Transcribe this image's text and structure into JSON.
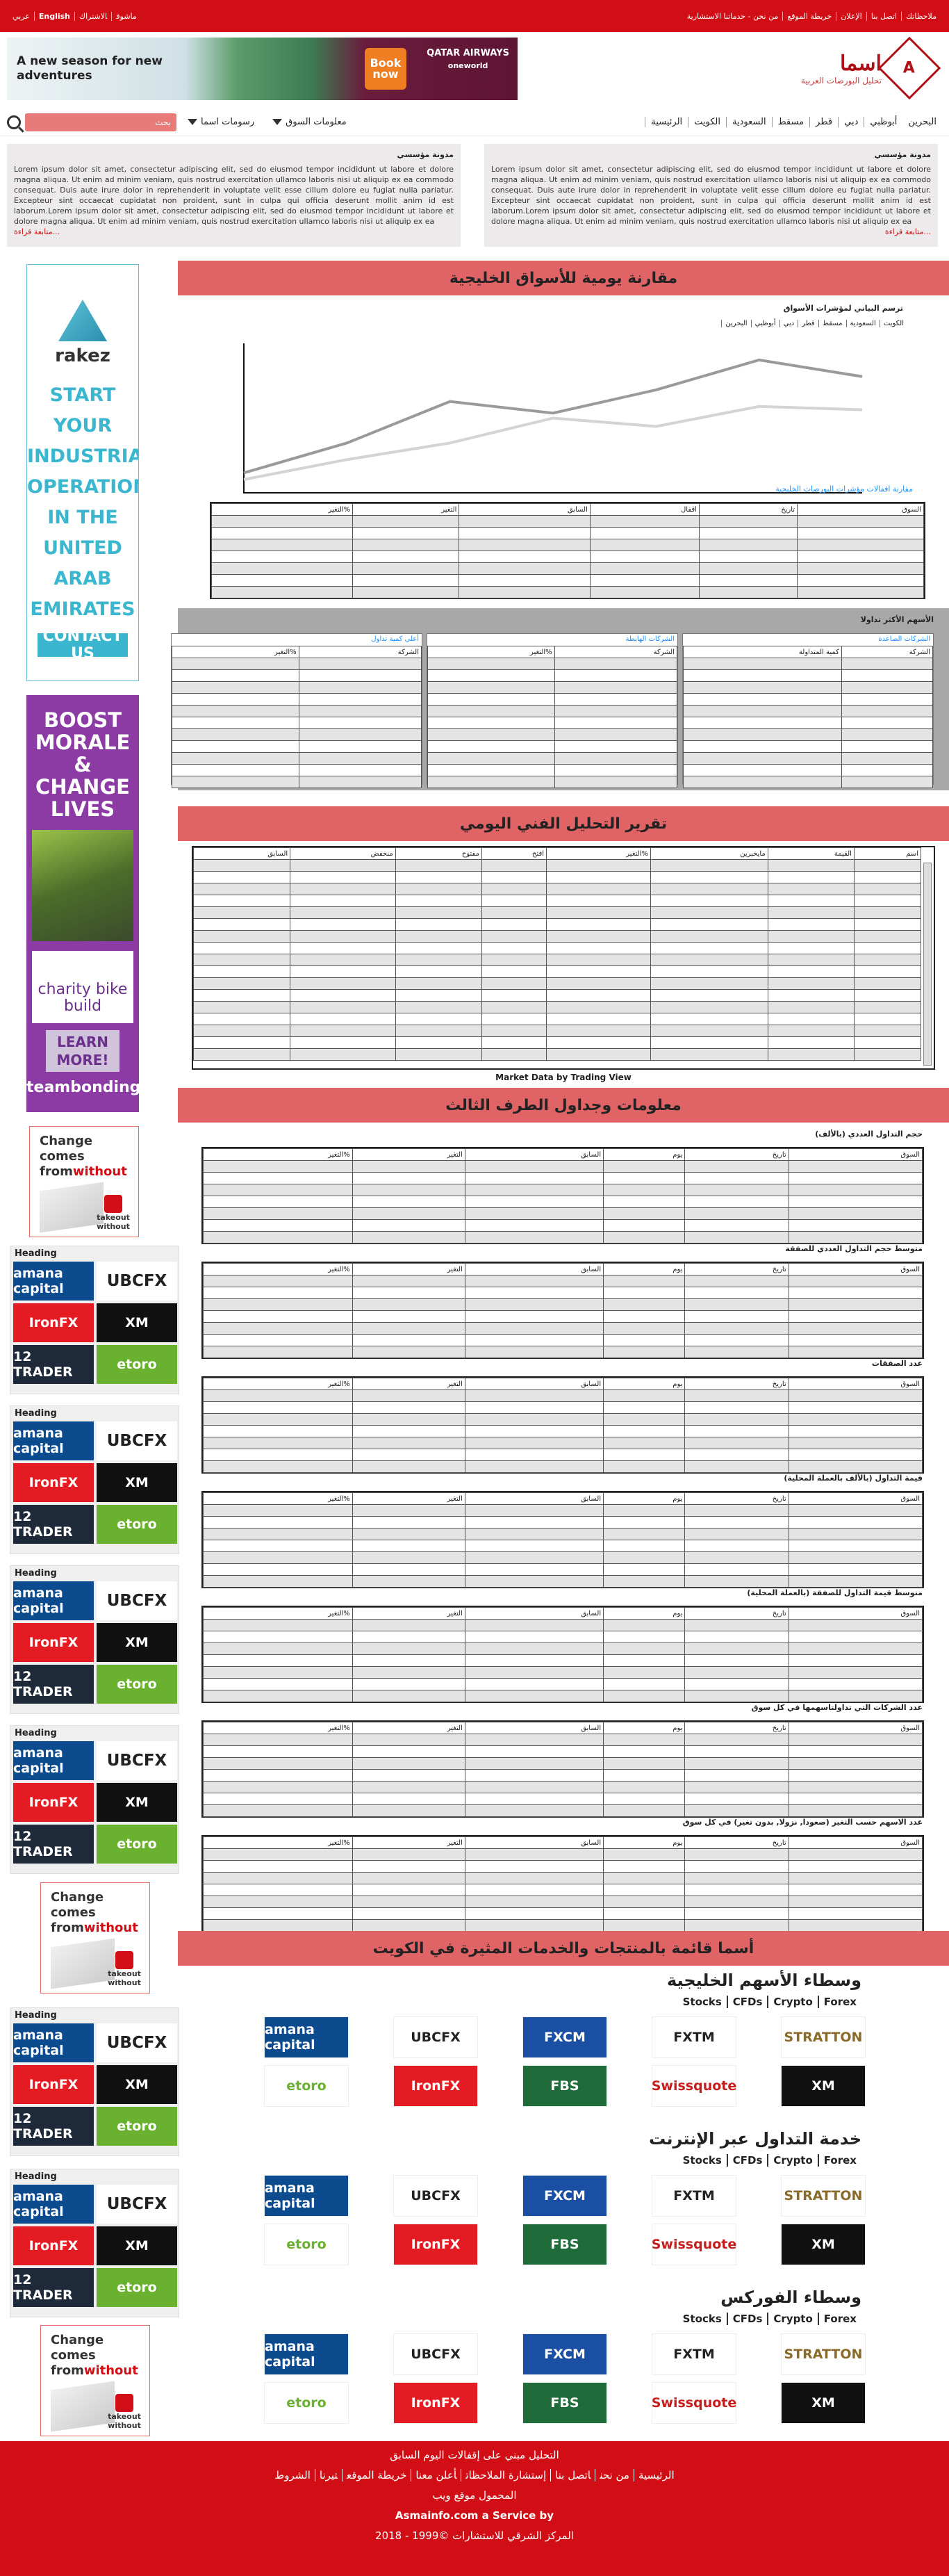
{
  "topbar": {
    "links": [
      "من نحن - خدماتنا الاستشارية",
      "خريطة الموقع",
      "الإعلان",
      "اتصل بنا",
      "ملاحظاتك"
    ],
    "lang": [
      "عربي",
      "English",
      "ماشوف",
      "الاشتراك"
    ]
  },
  "logo": {
    "name": "اسما",
    "tagline": "تحليل البورصات العربية"
  },
  "top_banner": {
    "text": "A new season for new adventures",
    "book": "Book now",
    "brand": "QATAR AIRWAYS",
    "alliance": "oneworld"
  },
  "nav": {
    "menu": [
      "الرئيسية",
      "الكويت",
      "السعودية",
      "مسقط",
      "قطر",
      "دبي",
      "أبوظبي",
      "البحرين"
    ],
    "dd1": "معلومات السوق",
    "dd2": "رسومات اسما",
    "search_placeholder": "بحث"
  },
  "blogs": [
    {
      "title": "مدونة مؤسسي",
      "body": "Lorem ipsum dolor sit amet, consectetur adipiscing elit, sed do eiusmod tempor incididunt ut labore et dolore magna aliqua. Ut enim ad minim veniam, quis nostrud exercitation ullamco laboris nisi ut aliquip ex ea commodo consequat. Duis aute irure dolor in reprehenderit in voluptate velit esse cillum dolore eu fugiat nulla pariatur. Excepteur sint occaecat cupidatat non proident, sunt in culpa qui officia deserunt mollit anim id est laborum.Lorem ipsum dolor sit amet, consectetur adipiscing elit, sed do eiusmod tempor incididunt ut labore et dolore magna aliqua. Ut enim ad minim veniam, quis nostrud exercitation ullamco laboris nisi ut aliquip ex ea",
      "more": "متابعة قراءة..."
    },
    {
      "title": "مدونة مؤسسي",
      "body": "Lorem ipsum dolor sit amet, consectetur adipiscing elit, sed do eiusmod tempor incididunt ut labore et dolore magna aliqua. Ut enim ad minim veniam, quis nostrud exercitation ullamco laboris nisi ut aliquip ex ea commodo consequat. Duis aute irure dolor in reprehenderit in voluptate velit esse cillum dolore eu fugiat nulla pariatur. Excepteur sint occaecat cupidatat non proident, sunt in culpa qui officia deserunt mollit anim id est laborum.Lorem ipsum dolor sit amet, consectetur adipiscing elit, sed do eiusmod tempor incididunt ut labore et dolore magna aliqua. Ut enim ad minim veniam, quis nostrud exercitation ullamco laboris nisi ut aliquip ex ea",
      "more": "متابعة قراءة..."
    }
  ],
  "sections": {
    "daily": "مقارنة يومية للأسواق الخليجية",
    "tech": "تقرير التحليل الفني اليومي",
    "third": "معلومات وجداول الطرف الثالث",
    "brokers": "أسما قائمة بالمنتجات والخدمات المثيرة في الكويت"
  },
  "chart_data": {
    "type": "line",
    "title": "ترسم البياني لمؤشرات الأسواق",
    "tabs": [
      "الكويت",
      "السعودية",
      "مسقط",
      "قطر",
      "دبي",
      "أبوظبي",
      "البحرين"
    ],
    "x": [
      0,
      1,
      2,
      3,
      4,
      5,
      6
    ],
    "series": [
      {
        "values": [
          12,
          30,
          55,
          48,
          62,
          80,
          70
        ]
      },
      {
        "values": [
          8,
          20,
          30,
          45,
          40,
          52,
          50
        ]
      }
    ],
    "colors": [
      "#9a9a9a",
      "#d4d4d4"
    ],
    "ylim": [
      0,
      90
    ]
  },
  "compare_table": {
    "title": "مقارنة اقفالات مؤشرات البورصات الخليجية",
    "headers": [
      "السوق",
      "تاريخ",
      "اقفال",
      "السابق",
      "التغير",
      "%التغير"
    ],
    "rows": 8
  },
  "most_active": {
    "title": "الأسهم الأكثر تداولا",
    "panels": [
      {
        "title": "الشركات الصاعدة",
        "headers": [
          "الشركة",
          "كمية المتداولة"
        ]
      },
      {
        "title": "الشركات الهابطة",
        "headers": [
          "الشركة",
          "%التغير"
        ]
      },
      {
        "title": "أعلى كمية تداول",
        "headers": [
          "الشركة",
          "%التغير"
        ]
      }
    ]
  },
  "tech_table": {
    "headers": [
      "اسم",
      "القيمة",
      "مايخبرين",
      "%التغير",
      "افتح",
      "مفتوح",
      "منخفض",
      "السابق"
    ],
    "credit": "Market Data by Trading View"
  },
  "third_tables": [
    {
      "title": "حجم التداول العددي (بالألف)"
    },
    {
      "title": "متوسط حجم التداول العددي للصفقة"
    },
    {
      "title": "عدد الصفقات"
    },
    {
      "title": "قيمة التداول (بالألف بالعملة المحلية)"
    },
    {
      "title": "متوسط قيمة التداول للصفقة (بالعملة المحلية)"
    },
    {
      "title": "عدد الشركات التي تداولتاسهمها في كل سوق"
    },
    {
      "title": "عدد الاسهم حسب التغير (صعودا, نزولا, بدون تغير) في كل سوق"
    }
  ],
  "third_headers": [
    "السوق",
    "تاريخ",
    "يوم",
    "السابق",
    "التغير",
    "%التغير"
  ],
  "ads": {
    "rakez": {
      "logo": "rakez",
      "lines": [
        "START YOUR",
        "INDUSTRIAL",
        "OPERATIONS",
        "IN THE",
        "UNITED",
        "ARAB",
        "EMIRATES"
      ],
      "cta": "CONTACT US"
    },
    "charity": {
      "head": "BOOST MORALE & CHANGE LIVES",
      "brand": "charity bike build",
      "cta": "LEARN MORE!",
      "maker": "teambonding"
    },
    "takeout": {
      "line1": "Change comes",
      "line2": "from",
      "line3": "without",
      "brand": "takeout without"
    },
    "broker_box": {
      "heading": "Heading",
      "tiles": [
        "amana capital",
        "UBCFX",
        "IronFX",
        "XM",
        "12 TRADER",
        "etoro"
      ]
    }
  },
  "broker_rows": [
    {
      "title": "وسطاء الأسهم الخليجية",
      "tags": [
        "Forex",
        "Crypto",
        "CFDs",
        "Stocks"
      ]
    },
    {
      "title": "خدمة التداول عبر الإنترنت",
      "tags": [
        "Forex",
        "Crypto",
        "CFDs",
        "Stocks"
      ]
    },
    {
      "title": "وسطاء الفوركس",
      "tags": [
        "Forex",
        "Crypto",
        "CFDs",
        "Stocks"
      ]
    }
  ],
  "broker_tiles": [
    "amana capital",
    "UBCFX",
    "FXCM",
    "FXTM",
    "STRATTON",
    "etoro",
    "IronFX",
    "FBS",
    "Swissquote",
    "XM"
  ],
  "footer": {
    "line1": "التحليل مبني على إقفالات اليوم السابق",
    "links": [
      "الرئيسية",
      "من نحن",
      "اتصل بنا",
      "إستشارة الملاحظات",
      "أعلن معنا",
      "خريطة الموقع",
      "تيرنا",
      "الشروط"
    ],
    "line3": "المحمول موقع ويب",
    "line4": "Asmainfo.com a Service by",
    "line5": "المركز الشرقي للاستشارات ©1999 - 2018"
  }
}
